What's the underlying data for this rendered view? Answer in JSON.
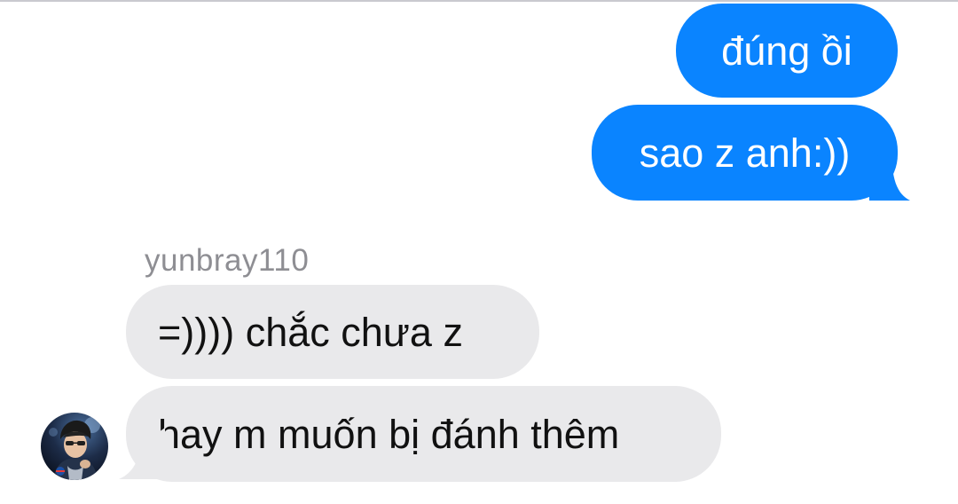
{
  "conversation": {
    "messages": [
      {
        "direction": "outgoing",
        "text": "đúng ồi"
      },
      {
        "direction": "outgoing",
        "text": "sao z anh:))"
      },
      {
        "direction": "incoming",
        "text": "=)))) chắc chưa z"
      },
      {
        "direction": "incoming",
        "text": "hay m muốn bị đánh thêm"
      }
    ],
    "incoming_sender": "yunbray110"
  },
  "colors": {
    "outgoing_bubble": "#0a84ff",
    "incoming_bubble": "#e9e9eb",
    "sender_label": "#8e8e93",
    "background": "#ffffff"
  },
  "icons": {
    "avatar": "user-avatar-photo"
  }
}
